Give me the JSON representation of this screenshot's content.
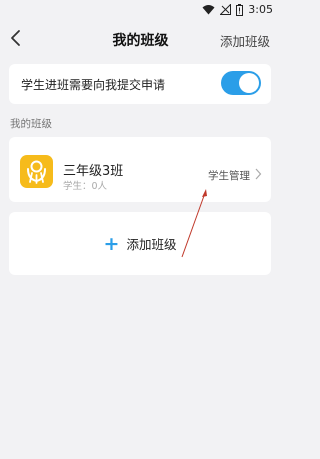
{
  "status_bar": {
    "time": "3:05",
    "icons": [
      "wifi-icon",
      "signal-icon",
      "battery-icon"
    ]
  },
  "nav": {
    "back_icon": "back-arrow-icon",
    "title": "我的班级",
    "action_label": "添加班级"
  },
  "setting": {
    "label": "学生进班需要向我提交申请",
    "enabled": true
  },
  "section": {
    "title": "我的班级"
  },
  "classes": [
    {
      "name": "三年级3班",
      "students": "学生：0人",
      "manage_label": "学生管理",
      "icon": "class-logo-icon"
    }
  ],
  "add_class": {
    "label": "添加班级",
    "icon": "plus-icon"
  },
  "colors": {
    "accent": "#2b9ee8",
    "class_icon_bg": "#f6bb1b",
    "annotation_arrow": "#c0392b"
  }
}
